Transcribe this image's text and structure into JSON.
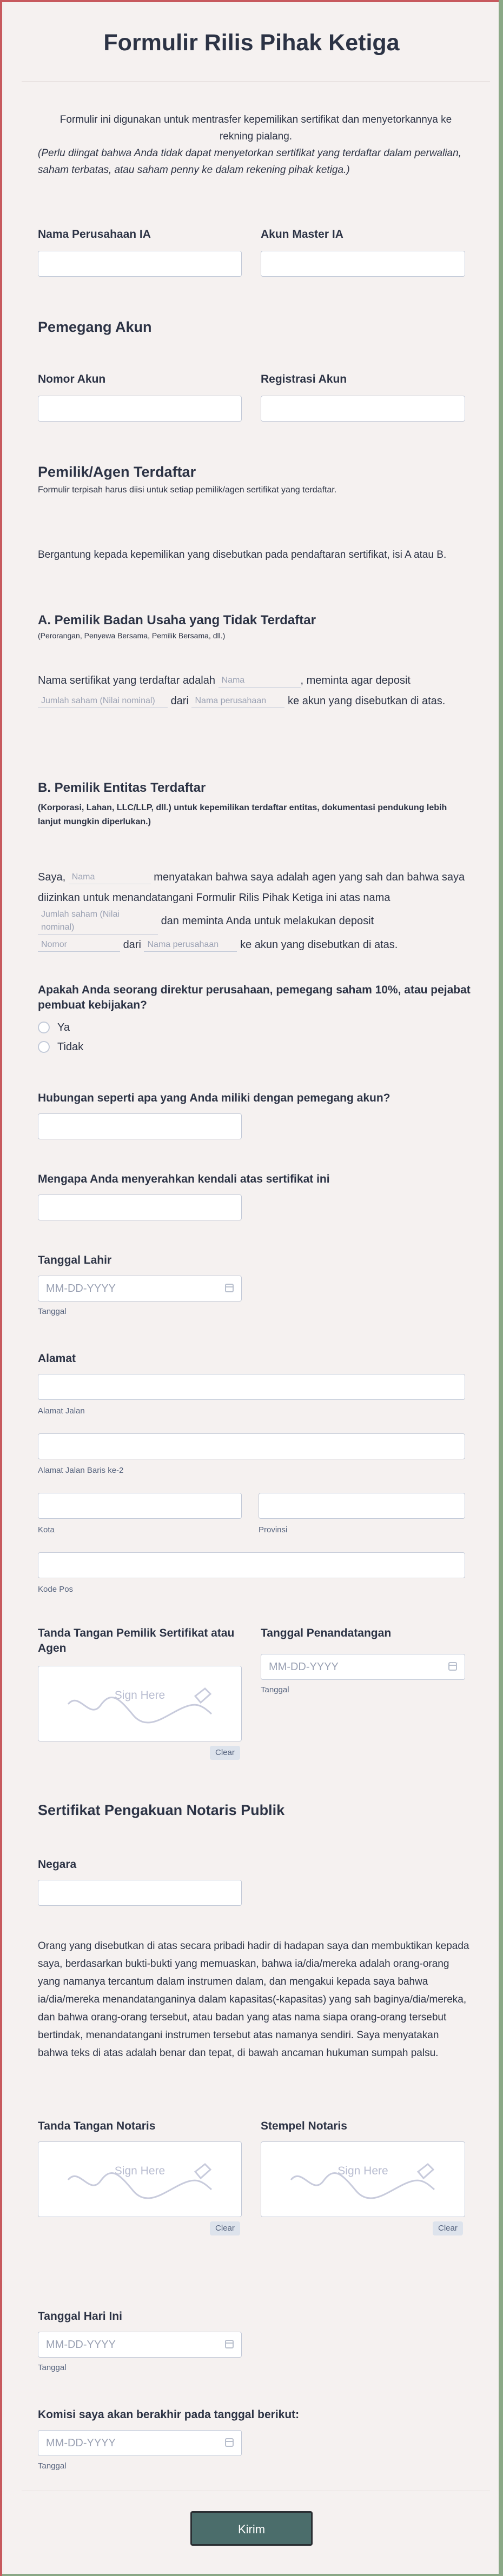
{
  "form": {
    "title": "Formulir Rilis Pihak Ketiga",
    "intro": "Formulir ini digunakan untuk mentrasfer kepemilikan sertifikat dan menyetorkannya ke rekning pialang.",
    "intro_note": "(Perlu diingat bahwa Anda tidak dapat menyetorkan sertifikat yang terdaftar dalam perwalian, saham terbatas, atau saham penny ke dalam rekening pihak ketiga.)",
    "ia_company_label": "Nama Perusahaan IA",
    "master_account_label": "Akun Master IA",
    "account_holder_heading": "Pemegang Akun",
    "account_number_label": "Nomor Akun",
    "account_registration_label": "Registrasi Akun",
    "registered_owner_heading": "Pemilik/Agen Terdaftar",
    "registered_owner_sub": "Formulir terpisah harus diisi untuk setiap pemilik/agen sertifikat yang terdaftar.",
    "registered_owner_note": "Bergantung kepada kepemilikan yang disebutkan pada pendaftaran sertifikat, isi A atau B.",
    "section_a_heading": "A. Pemilik Badan Usaha yang Tidak Terdaftar",
    "section_a_sub": "(Perorangan, Penyewa Bersama, Pemilik Bersama, dll.)",
    "section_a": {
      "t1": "Nama sertifikat yang terdaftar adalah",
      "p_name": "Nama",
      "t2": ", meminta agar deposit",
      "p_amount": "Jumlah saham (Nilai nominal)",
      "t3": "dari",
      "p_company": "Nama perusahaan",
      "t4": "ke akun yang disebutkan di atas."
    },
    "section_b_heading": "B. Pemilik Entitas Terdaftar",
    "section_b_sub": "(Korporasi, Lahan, LLC/LLP, dll.) untuk kepemilikan terdaftar entitas, dokumentasi pendukung lebih lanjut mungkin diperlukan.)",
    "section_b": {
      "t1": "Saya,",
      "p_name": "Nama",
      "t2": "menyatakan bahwa saya adalah agen yang sah dan bahwa saya diizinkan untuk menandatangani Formulir Rilis Pihak Ketiga ini atas nama",
      "p_amount": "Jumlah saham (Nilai nominal)",
      "t3": "dan meminta Anda untuk melakukan deposit",
      "p_number": "Nomor",
      "t4": "dari",
      "p_company": "Nama perusahaan",
      "t5": "ke akun yang disebutkan di atas."
    },
    "director_question": "Apakah Anda seorang direktur perusahaan, pemegang saham 10%, atau pejabat pembuat kebijakan?",
    "radio_yes": "Ya",
    "radio_no": "Tidak",
    "relationship_question": "Hubungan seperti apa yang Anda miliki dengan pemegang akun?",
    "reason_question": "Mengapa Anda menyerahkan kendali atas sertifikat ini",
    "birth_date_label": "Tanggal Lahir",
    "date_placeholder": "MM-DD-YYYY",
    "date_hint": "Tanggal",
    "address_label": "Alamat",
    "street_hint": "Alamat Jalan",
    "street2_hint": "Alamat Jalan Baris ke-2",
    "city_hint": "Kota",
    "province_hint": "Provinsi",
    "postal_hint": "Kode Pos",
    "owner_signature_label": "Tanda Tangan Pemilik Sertifikat atau Agen",
    "sign_date_label": "Tanggal Penandatangan",
    "sign_here": "Sign Here",
    "clear_label": "Clear",
    "notary_heading": "Sertifikat Pengakuan Notaris Publik",
    "country_label": "Negara",
    "notary_text": "Orang yang disebutkan di atas secara pribadi hadir di hadapan saya dan membuktikan kepada saya, berdasarkan bukti-bukti yang memuaskan, bahwa ia/dia/mereka adalah orang-orang yang namanya tercantum dalam instrumen dalam, dan mengakui kepada saya bahwa ia/dia/mereka menandatanganinya dalam kapasitas(-kapasitas) yang sah baginya/dia/mereka, dan bahwa orang-orang tersebut, atau badan yang atas nama siapa orang-orang tersebut bertindak, menandatangani instrumen tersebut atas namanya sendiri. Saya menyatakan bahwa teks di atas adalah benar dan tepat, di bawah ancaman hukuman sumpah palsu.",
    "notary_signature_label": "Tanda Tangan Notaris",
    "notary_stamp_label": "Stempel Notaris",
    "today_date_label": "Tanggal Hari Ini",
    "commission_label": "Komisi saya akan berakhir pada tanggal berikut:",
    "submit_label": "Kirim"
  }
}
